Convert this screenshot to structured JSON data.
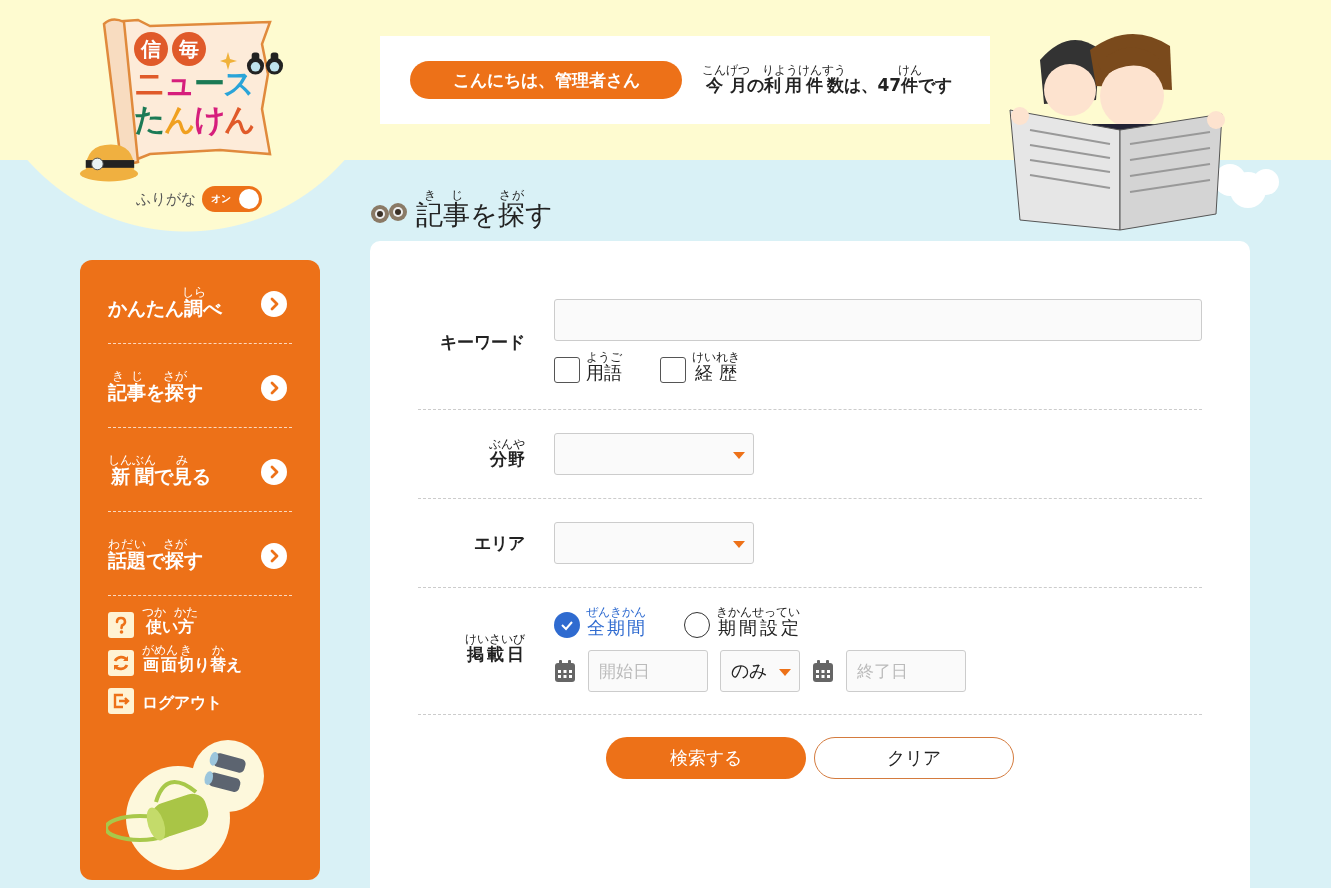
{
  "logo": {
    "badge": [
      "信",
      "毎"
    ],
    "lines": [
      "ニュース",
      "たんけん"
    ]
  },
  "furigana_toggle": {
    "label": "ふりがな",
    "state_text": "オン",
    "on": true
  },
  "greeting": "こんにちは、管理者さん",
  "usage": [
    [
      "こんげつ",
      "今月"
    ],
    [
      "の"
    ],
    [
      "りようけんすう",
      "利用件数"
    ],
    [
      "は、47"
    ],
    [
      "けん",
      "件"
    ],
    [
      "です"
    ]
  ],
  "page_title": [
    [
      "きじ",
      "記事"
    ],
    [
      "を"
    ],
    [
      "さが",
      "探"
    ],
    [
      "す"
    ]
  ],
  "sidebar": {
    "nav": [
      {
        "label": [
          [
            "かんたん"
          ],
          [
            "しら",
            "調"
          ],
          [
            "べ"
          ]
        ]
      },
      {
        "label": [
          [
            "きじ",
            "記事"
          ],
          [
            "を"
          ],
          [
            "さが",
            "探"
          ],
          [
            "す"
          ]
        ]
      },
      {
        "label": [
          [
            "しんぶん",
            "新聞"
          ],
          [
            "で"
          ],
          [
            "み",
            "見"
          ],
          [
            "る"
          ]
        ]
      },
      {
        "label": [
          [
            "わだい",
            "話題"
          ],
          [
            "で"
          ],
          [
            "さが",
            "探"
          ],
          [
            "す"
          ]
        ]
      }
    ],
    "links": [
      {
        "kind": "help",
        "label": [
          [
            "つか",
            "使"
          ],
          [
            "い"
          ],
          [
            "かた",
            "方"
          ]
        ]
      },
      {
        "kind": "switch",
        "label": [
          [
            "がめん",
            "画面"
          ],
          [
            "き",
            "切"
          ],
          [
            "り"
          ],
          [
            "か",
            "替"
          ],
          [
            "え"
          ]
        ]
      },
      {
        "kind": "logout",
        "label": [
          [
            "ログアウト"
          ]
        ]
      }
    ]
  },
  "form": {
    "keyword": {
      "label": [
        [
          "キーワード"
        ]
      ],
      "options": [
        {
          "label": [
            [
              "ようご",
              "用語"
            ]
          ],
          "checked": false
        },
        {
          "label": [
            [
              "けいれき",
              "経歴"
            ]
          ],
          "checked": false
        }
      ]
    },
    "genre": {
      "label": [
        [
          "ぶんや",
          "分野"
        ]
      ]
    },
    "area": {
      "label": [
        [
          "エリア"
        ]
      ]
    },
    "date": {
      "label": [
        [
          "けいさいび",
          "掲載日"
        ]
      ],
      "modes": [
        {
          "label": [
            [
              "ぜんきかん",
              "全期間"
            ]
          ],
          "selected": true
        },
        {
          "label": [
            [
              "きかんせってい",
              "期間設定"
            ]
          ],
          "selected": false
        }
      ],
      "start_placeholder": "開始日",
      "range": "のみ",
      "end_placeholder": "終了日"
    },
    "buttons": [
      {
        "kind": "primary",
        "label": "検索する"
      },
      {
        "kind": "secondary",
        "label": "クリア"
      }
    ]
  }
}
